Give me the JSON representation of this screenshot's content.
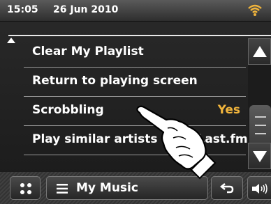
{
  "status": {
    "time": "15:05",
    "date": "26 Jun 2010",
    "signal_icon": "wifi-icon"
  },
  "menu": {
    "items": [
      {
        "label": "Clear My Playlist",
        "value": ""
      },
      {
        "label": "Return to playing screen",
        "value": ""
      },
      {
        "label": "Scrobbling",
        "value": "Yes"
      },
      {
        "label": "Play similar artists from Last.fm",
        "value": ""
      }
    ]
  },
  "scrollbar": {
    "up_icon": "triangle-up-icon",
    "down_icon": "triangle-down-icon",
    "position": 0.55
  },
  "bottom_bar": {
    "home_icon": "grid-icon",
    "music_icon": "list-icon",
    "music_label": "My Music",
    "back_icon": "back-arrow-icon",
    "volume_icon": "speaker-icon"
  },
  "colors": {
    "value_accent": "#f0b43c",
    "signal": "#f0b43c"
  }
}
